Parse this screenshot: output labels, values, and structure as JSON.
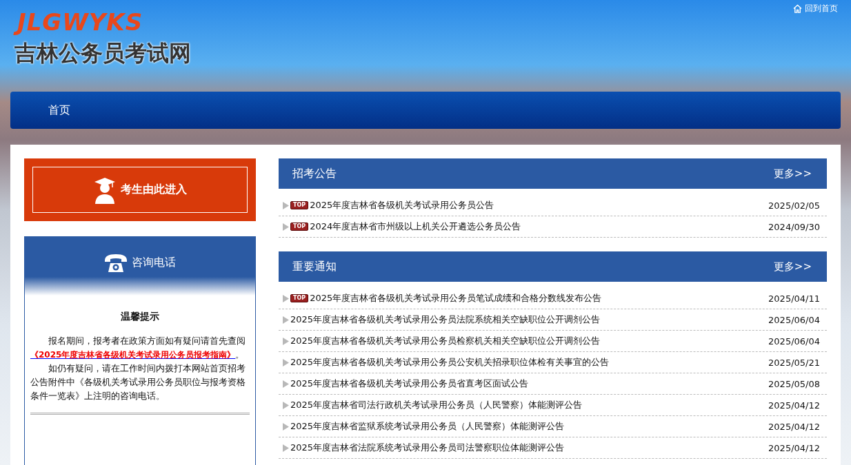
{
  "header": {
    "logo_latin": "JLGWYKS",
    "logo_title": "吉林公务员考试网",
    "home_link": "回到首页"
  },
  "nav": {
    "items": [
      {
        "label": "首页",
        "selected": false
      }
    ]
  },
  "entry_button": {
    "label": "考生由此进入"
  },
  "consult": {
    "title": "咨询电话",
    "tip_title": "温馨提示",
    "para1_before": "报名期间，报考者在政策方面如有疑问请首先查阅",
    "para1_link": "《2025年度吉林省各级机关考试录用公务员报考指南》",
    "para1_after": "。",
    "para2": "如仍有疑问，请在工作时间内拨打本网站首页招考公告附件中《各级机关考试录用公务员职位与报考资格条件一览表》上注明的咨询电话。"
  },
  "sections": [
    {
      "title": "招考公告",
      "more": "更多>>",
      "items": [
        {
          "badge": "TOP",
          "title": "2025年度吉林省各级机关考试录用公务员公告",
          "date": "2025/02/05"
        },
        {
          "badge": "TOP",
          "title": "2024年度吉林省市州级以上机关公开遴选公务员公告",
          "date": "2024/09/30"
        }
      ]
    },
    {
      "title": "重要通知",
      "more": "更多>>",
      "items": [
        {
          "badge": "TOP",
          "title": "2025年度吉林省各级机关考试录用公务员笔试成绩和合格分数线发布公告",
          "date": "2025/04/11"
        },
        {
          "title": "2025年度吉林省各级机关考试录用公务员法院系统相关空缺职位公开调剂公告",
          "date": "2025/06/04"
        },
        {
          "title": "2025年度吉林省各级机关考试录用公务员检察机关相关空缺职位公开调剂公告",
          "date": "2025/06/04"
        },
        {
          "title": "2025年度吉林省各级机关考试录用公务员公安机关招录职位体检有关事宜的公告",
          "date": "2025/05/21"
        },
        {
          "title": "2025年度吉林省各级机关考试录用公务员省直考区面试公告",
          "date": "2025/05/08"
        },
        {
          "title": "2025年度吉林省司法行政机关考试录用公务员（人民警察）体能测评公告",
          "date": "2025/04/12"
        },
        {
          "title": "2025年度吉林省监狱系统考试录用公务员（人民警察）体能测评公告",
          "date": "2025/04/12"
        },
        {
          "title": "2025年度吉林省法院系统考试录用公务员司法警察职位体能测评公告",
          "date": "2025/04/12"
        }
      ]
    }
  ]
}
